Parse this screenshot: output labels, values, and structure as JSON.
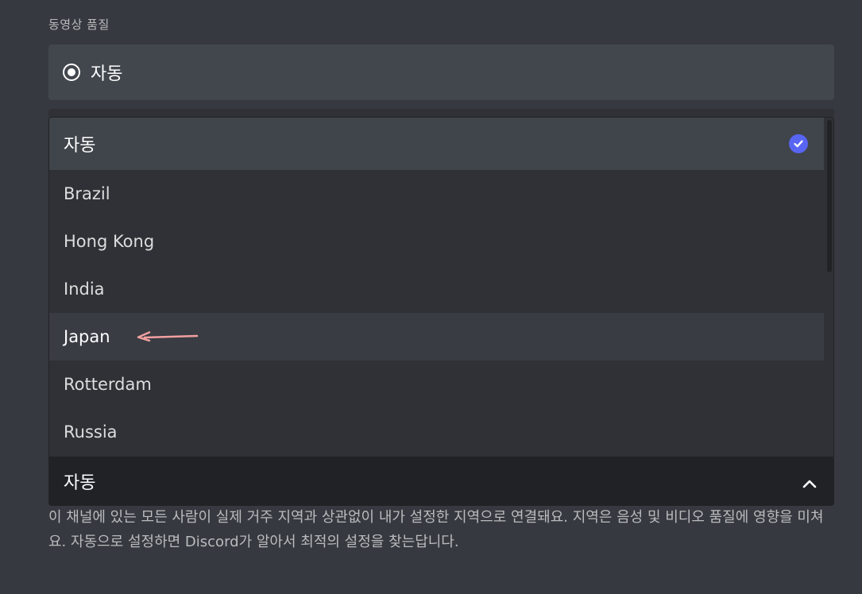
{
  "section_title": "동영상 품질",
  "radio": {
    "label": "자동",
    "checked": true
  },
  "dropdown": {
    "options": [
      {
        "label": "자동",
        "selected": true
      },
      {
        "label": "Brazil"
      },
      {
        "label": "Hong Kong"
      },
      {
        "label": "India"
      },
      {
        "label": "Japan",
        "highlighted": true
      },
      {
        "label": "Rotterdam"
      },
      {
        "label": "Russia"
      }
    ],
    "current_value": "자동",
    "expanded": true
  },
  "help_text": "이 채널에 있는 모든 사람이 실제 거주 지역과 상관없이 내가 설정한 지역으로 연결돼요. 지역은 음성 및 비디오 품질에 영향을 미쳐요. 자동으로 설정하면 Discord가 알아서 최적의 설정을 찾는답니다.",
  "colors": {
    "background": "#36393f",
    "accent": "#5865f2",
    "annotation_arrow": "#f2a0a0"
  }
}
